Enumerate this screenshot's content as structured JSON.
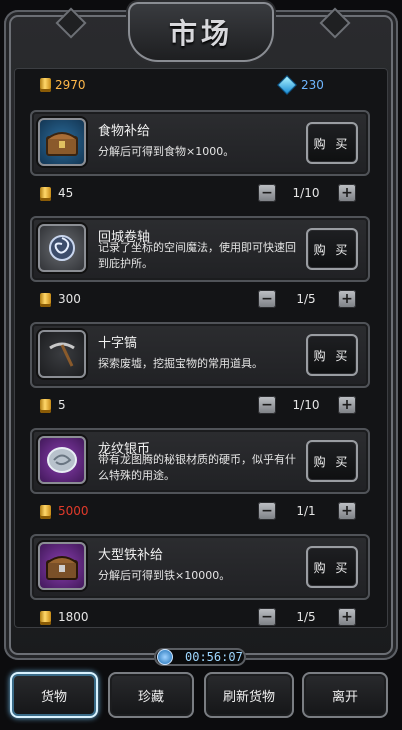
{
  "title": "市场",
  "currency": {
    "gold": "2970",
    "gems": "230"
  },
  "buy_label": "购 买",
  "items": [
    {
      "name": "食物补给",
      "desc": "分解后可得到食物×1000。",
      "price": "45",
      "qty": "1/10",
      "icon": "treasure-chest-icon"
    },
    {
      "name": "回城卷轴",
      "desc": "记录了坐标的空间魔法，使用即可快速回到庇护所。",
      "price": "300",
      "qty": "1/5",
      "icon": "scroll-vortex-icon"
    },
    {
      "name": "十字镐",
      "desc": "探索废墟，挖掘宝物的常用道具。",
      "price": "5",
      "qty": "1/10",
      "icon": "pickaxe-icon"
    },
    {
      "name": "龙纹银币",
      "desc": "带有龙图腾的秘银材质的硬币，似乎有什么特殊的用途。",
      "price": "5000",
      "qty": "1/1",
      "icon": "silver-coin-icon",
      "price_color": "#e03a2a"
    },
    {
      "name": "大型铁补给",
      "desc": "分解后可得到铁×10000。",
      "price": "1800",
      "qty": "1/5",
      "icon": "iron-chest-icon"
    }
  ],
  "stepper": {
    "minus": "−",
    "plus": "+"
  },
  "timer": "00:56:07",
  "tabs": [
    {
      "label": "货物",
      "active": true
    },
    {
      "label": "珍藏"
    },
    {
      "label": "刷新货物"
    },
    {
      "label": "离开"
    }
  ],
  "colors": {
    "price_insufficient": "#e03a2a",
    "gem": "#1b8fd6",
    "gold": "#ffd76a"
  }
}
